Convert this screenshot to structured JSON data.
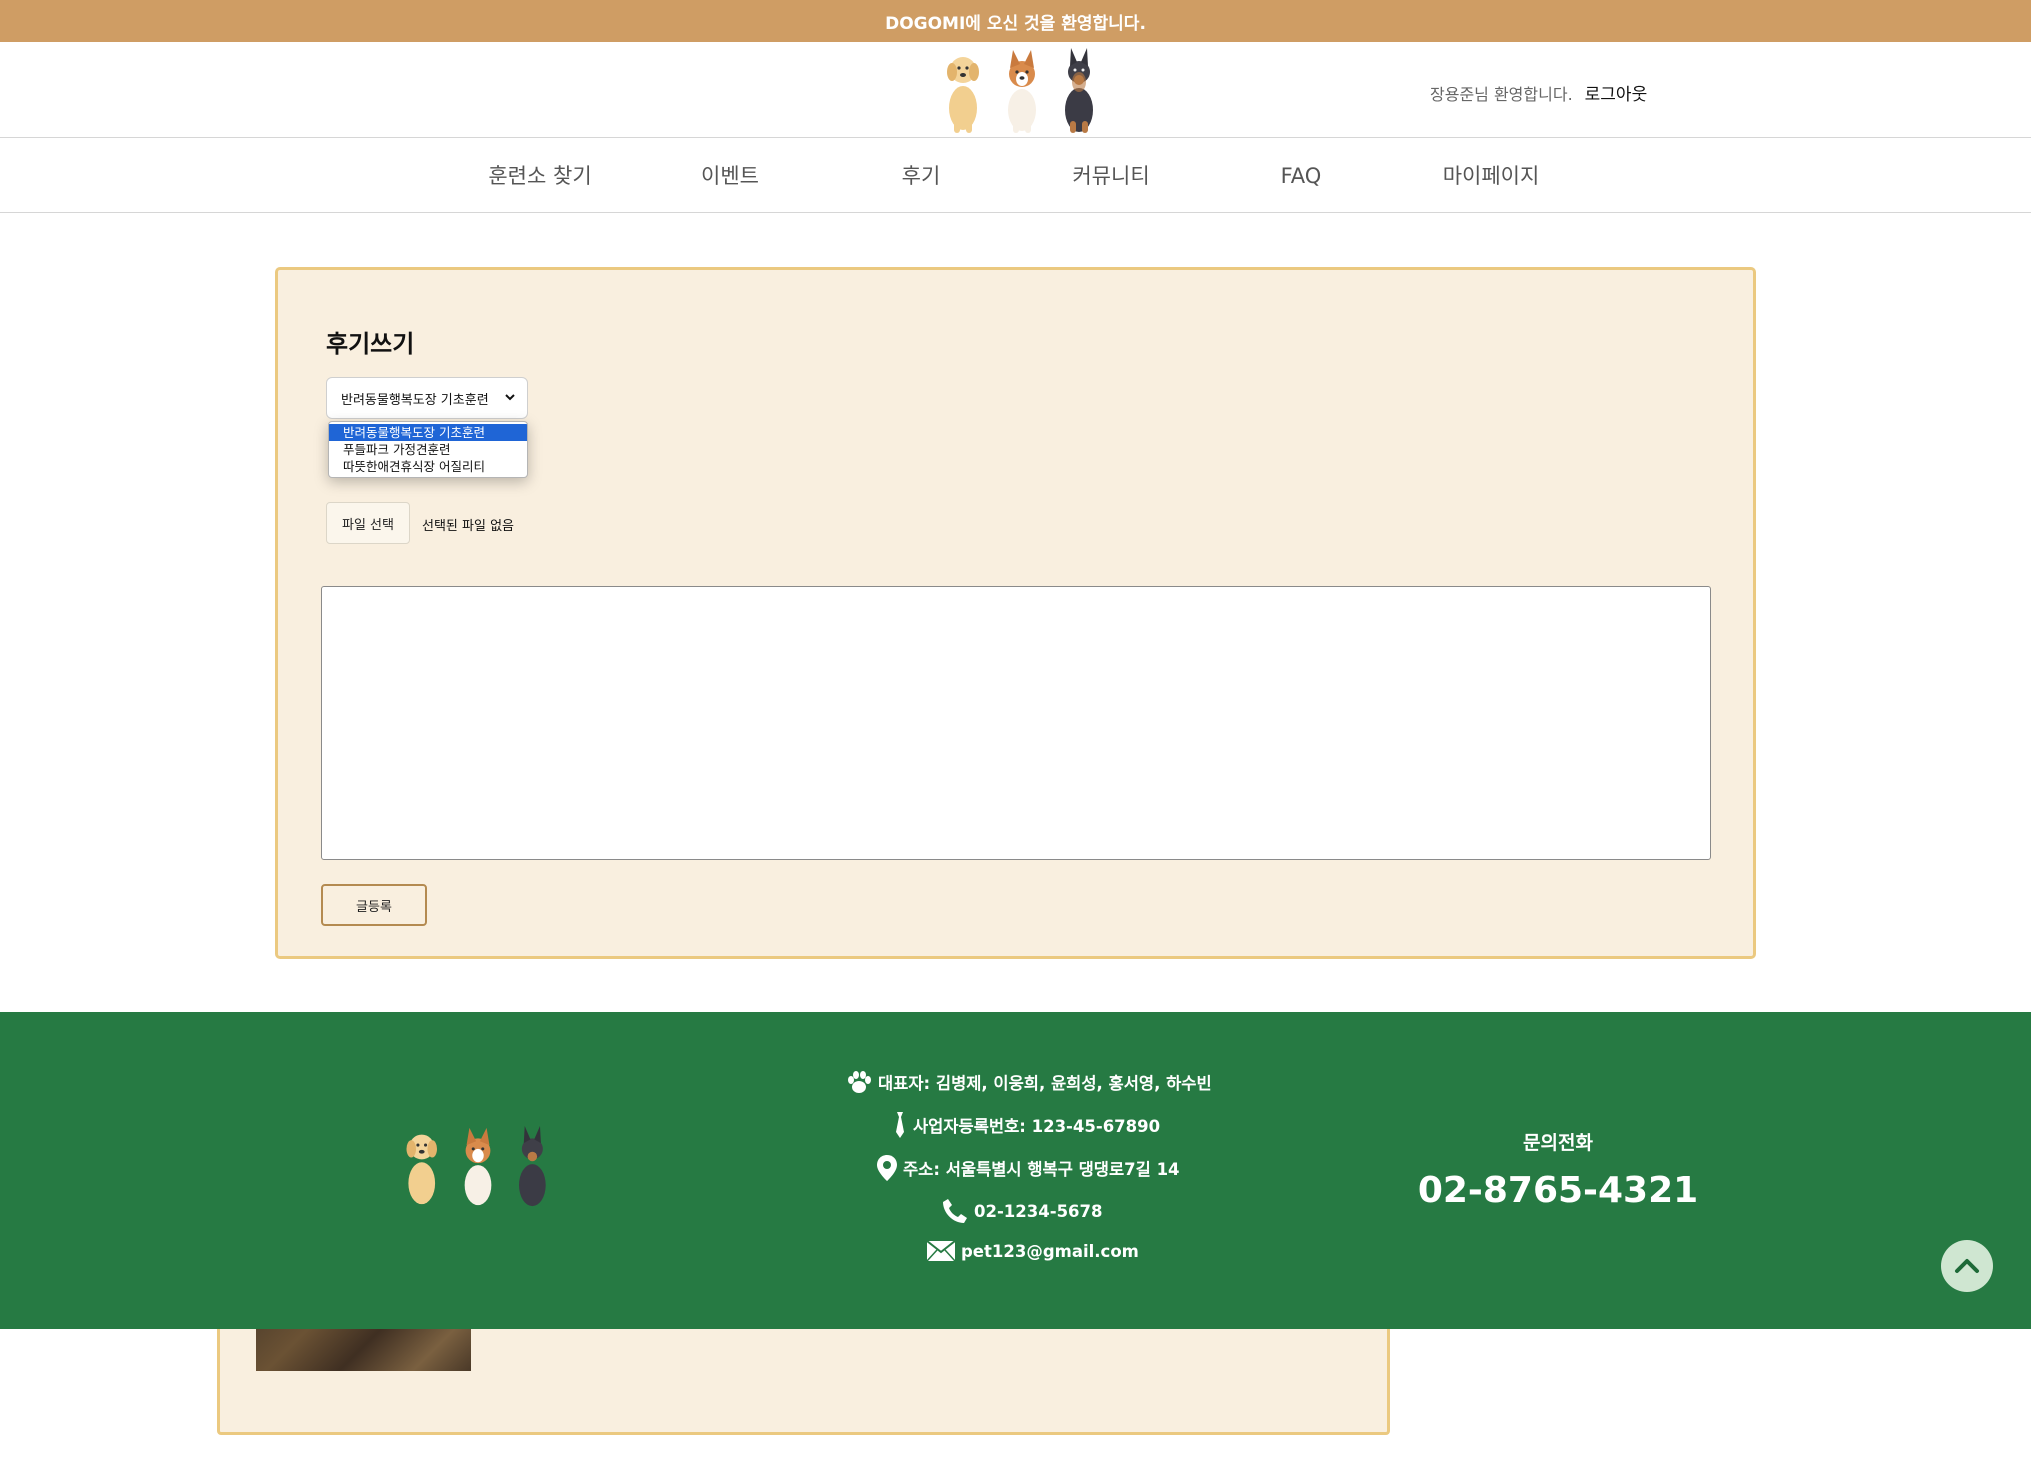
{
  "topbar": {
    "text": "DOGOMI에 오신 것을 환영합니다."
  },
  "header": {
    "logo_icon": "three-dogs-logo",
    "welcome": "장용준님 환영합니다.",
    "logout_label": "로그아웃"
  },
  "nav": {
    "items": [
      {
        "label": "훈련소 찾기"
      },
      {
        "label": "이벤트"
      },
      {
        "label": "후기"
      },
      {
        "label": "커뮤니티"
      },
      {
        "label": "FAQ"
      },
      {
        "label": "마이페이지"
      }
    ]
  },
  "review_form": {
    "title": "후기쓰기",
    "selected_option": "반려동물행복도장 기초훈련",
    "options": [
      {
        "label": "반려동물행복도장 기초훈련"
      },
      {
        "label": "푸들파크 가정견훈련"
      },
      {
        "label": "따뜻한애견휴식장 어질리티"
      }
    ],
    "file_button_label": "파일 선택",
    "file_status": "선택된 파일 없음",
    "content_value": "",
    "submit_label": "글등록"
  },
  "footer": {
    "representatives": "대표자: 김병제, 이웅희, 윤희성, 홍서영, 하수빈",
    "business_number": "사업자등록번호: 123-45-67890",
    "address": "주소: 서울특별시 행복구 댕댕로7길 14",
    "phone": "02-1234-5678",
    "email": "pet123@gmail.com",
    "contact_label": "문의전화",
    "contact_phone": "02-8765-4321",
    "icons": [
      "paw-icon",
      "tie-icon",
      "location-pin-icon",
      "phone-icon",
      "mail-icon"
    ]
  },
  "colors": {
    "topbar": "#cf9d64",
    "form_background": "#f9efdf",
    "form_border": "#ebc980",
    "footer": "#267a43",
    "selected_option": "#1f65d6"
  }
}
